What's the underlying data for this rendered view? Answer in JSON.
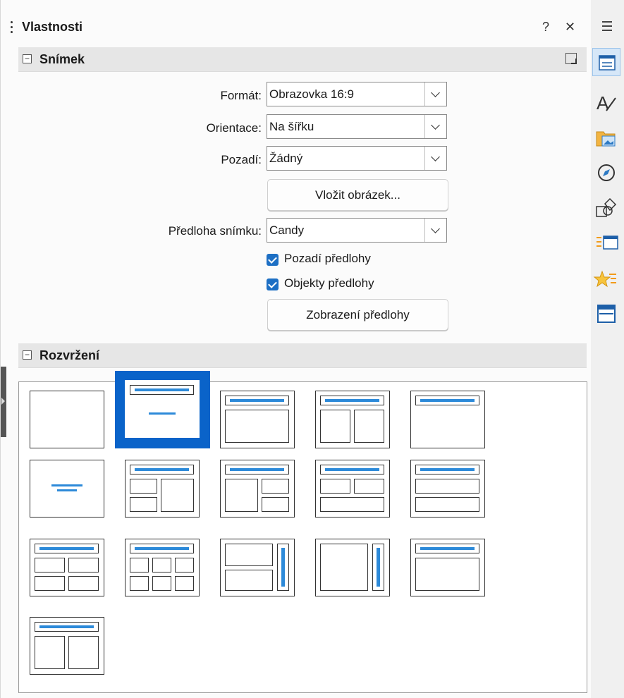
{
  "panel": {
    "title": "Vlastnosti",
    "help_label": "?",
    "close_label": "✕"
  },
  "slide_section": {
    "title": "Snímek",
    "format_label": "Formát:",
    "format_value": "Obrazovka 16:9",
    "orientation_label": "Orientace:",
    "orientation_value": "Na šířku",
    "background_label": "Pozadí:",
    "background_value": "Žádný",
    "insert_image_label": "Vložit obrázek...",
    "master_label": "Předloha snímku:",
    "master_value": "Candy",
    "master_background_label": "Pozadí předlohy",
    "master_background_checked": true,
    "master_objects_label": "Objekty předlohy",
    "master_objects_checked": true,
    "master_view_label": "Zobrazení předlohy"
  },
  "layout_section": {
    "title": "Rozvržení",
    "selected_index": 1,
    "layouts": [
      "blank",
      "title-content-center",
      "title-content",
      "title-two-content",
      "title-only",
      "centered-text",
      "title-2content-content",
      "title-content-2content",
      "title-2content-over-content",
      "title-content-over-content",
      "title-4content",
      "title-6content",
      "vertical-title-2content",
      "vertical-title-content",
      "title-content-vertical",
      "title-2content-vertical"
    ]
  },
  "sidebar": {
    "items": [
      "properties-icon",
      "styles-icon",
      "gallery-icon",
      "navigator-icon",
      "shapes-icon",
      "slide-transition-icon",
      "animation-icon",
      "master-slides-icon"
    ],
    "active": "properties-icon"
  },
  "colors": {
    "accent": "#0a63c9",
    "layout_bar": "#2d8ad9"
  }
}
